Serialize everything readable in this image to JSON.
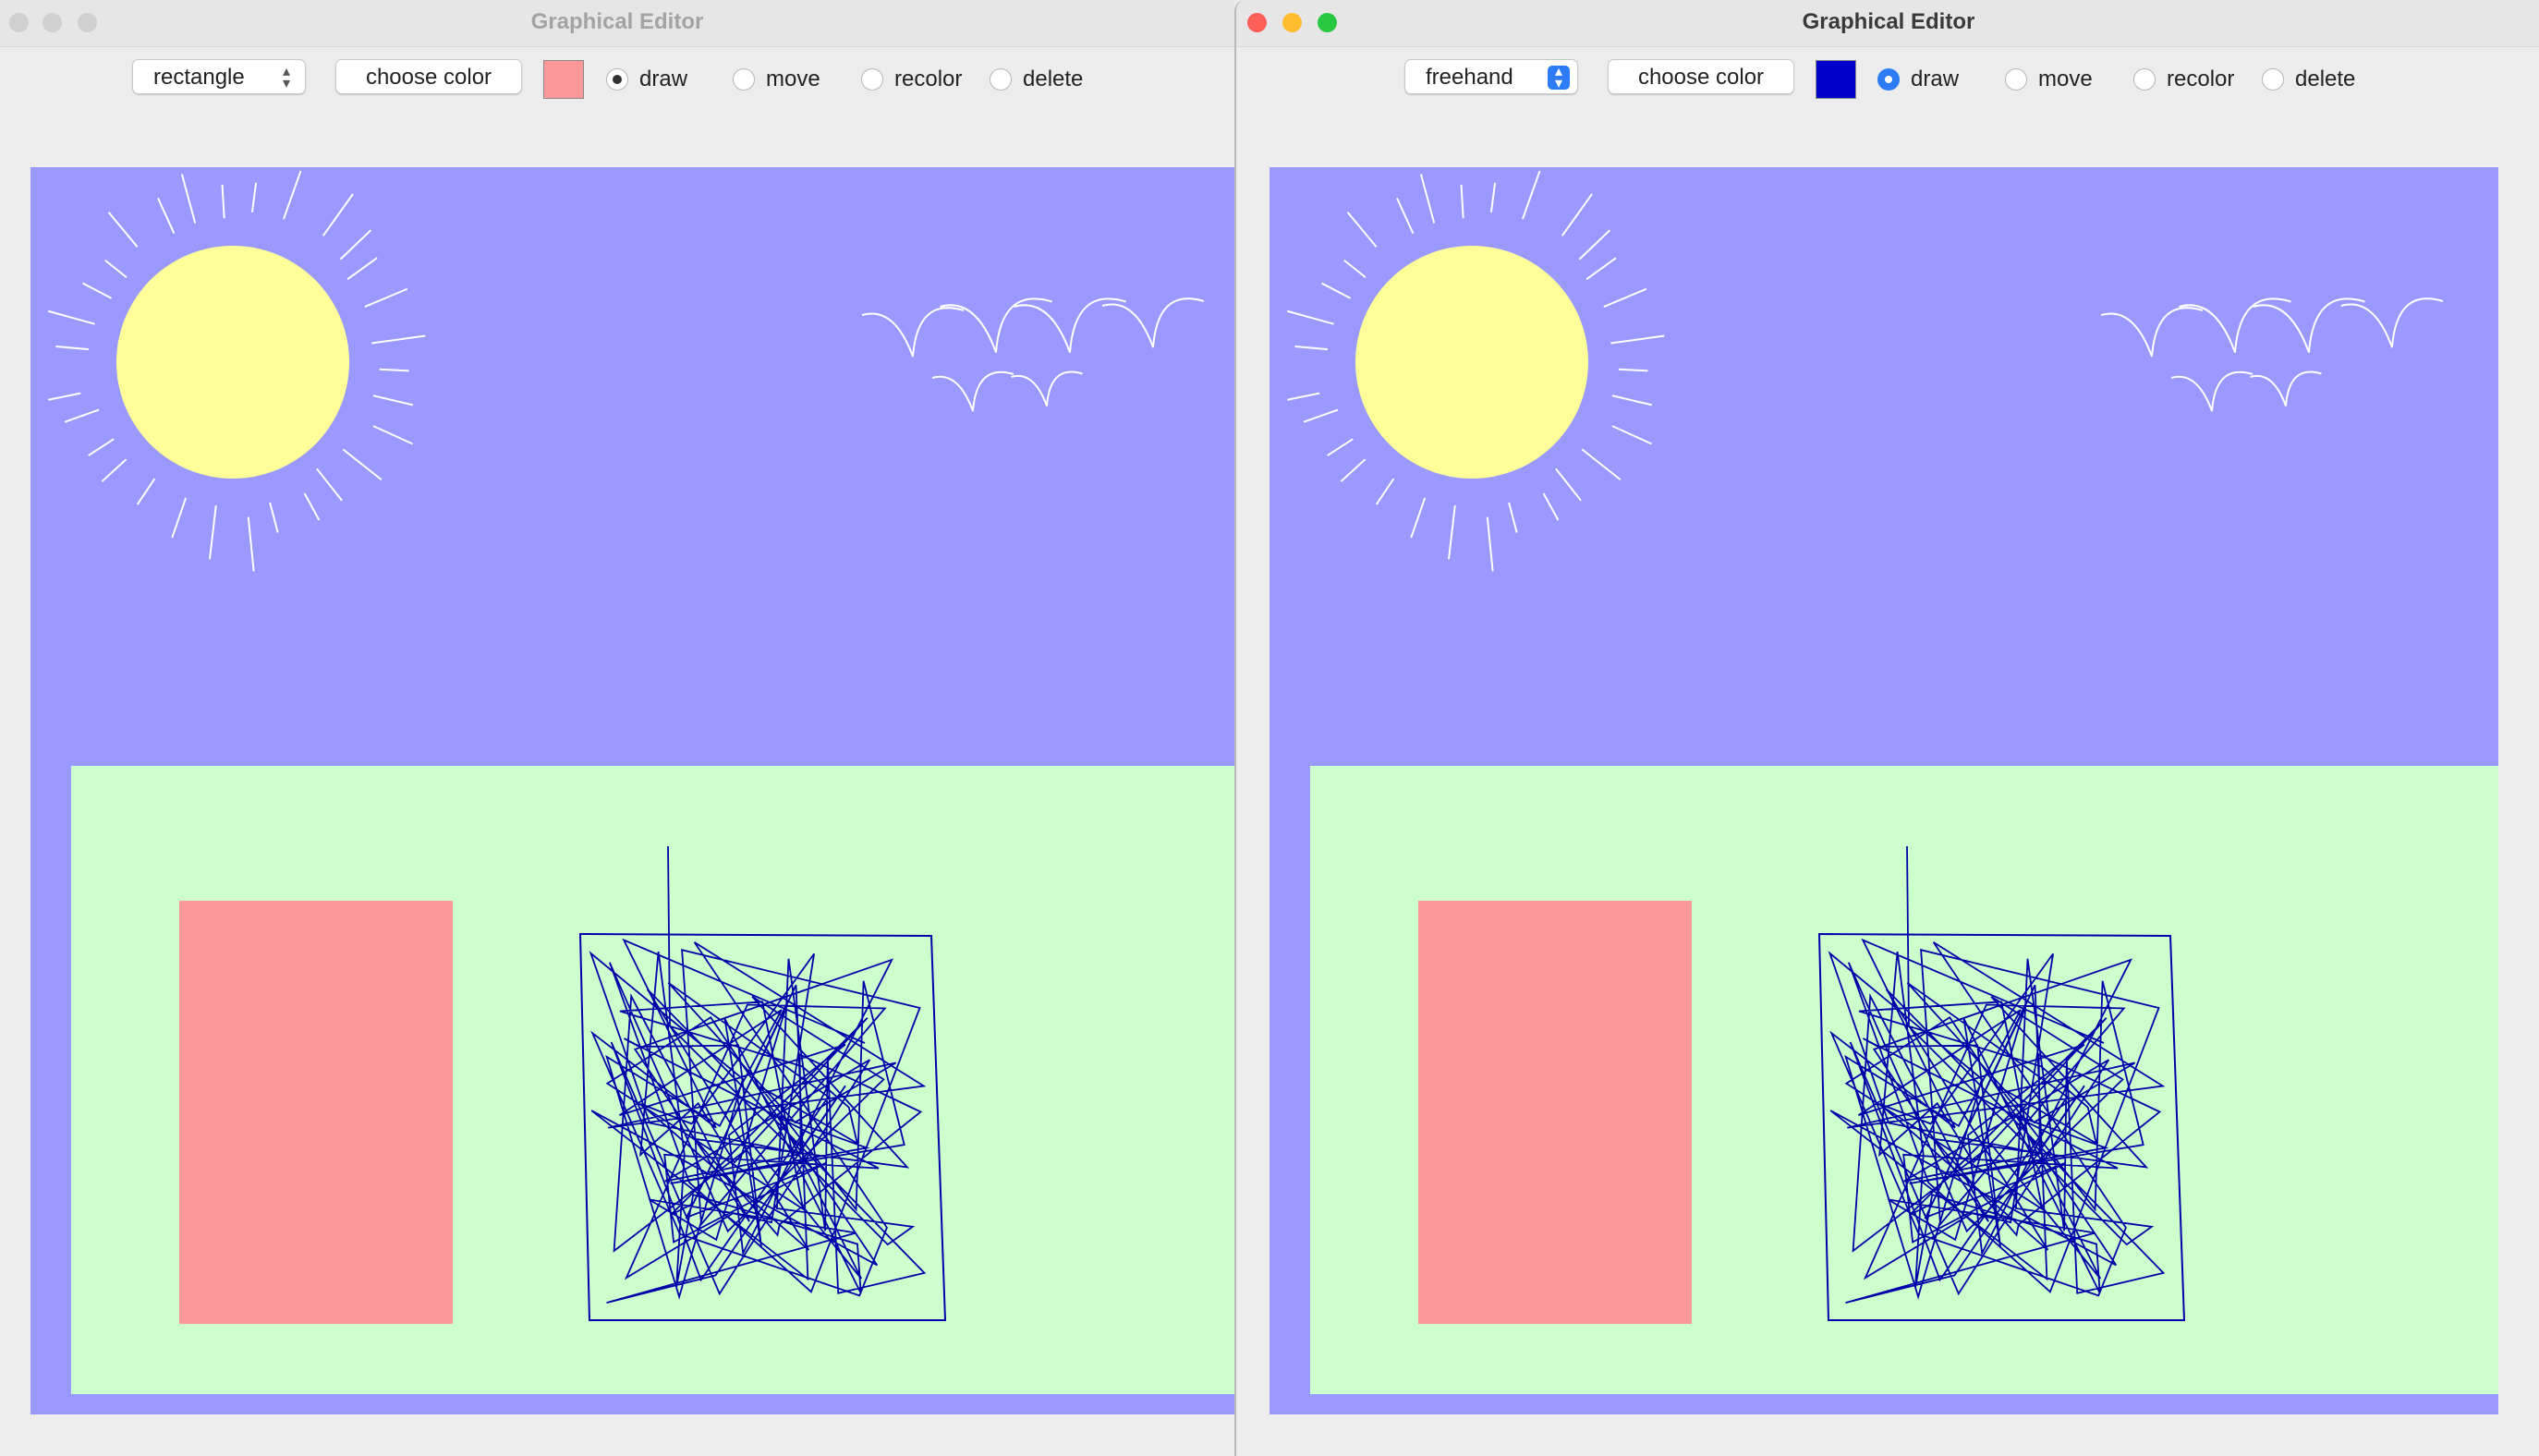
{
  "windows": [
    {
      "title": "Graphical Editor",
      "shape_select": "rectangle",
      "choose_color_label": "choose color",
      "current_color": "#ff9999",
      "modes": [
        "draw",
        "move",
        "recolor",
        "delete"
      ],
      "selected_mode": "draw"
    },
    {
      "title": "Graphical Editor",
      "shape_select": "freehand",
      "choose_color_label": "choose color",
      "current_color": "#0000cc",
      "modes": [
        "draw",
        "move",
        "recolor",
        "delete"
      ],
      "selected_mode": "draw"
    }
  ],
  "scene": {
    "sky_color": "#9999ff",
    "grass_color": "#ccffcc",
    "sun_color": "#ffff99",
    "rectangle_color": "#ff9999",
    "scribble_color": "#0000aa",
    "birds_color": "#ffffff"
  }
}
